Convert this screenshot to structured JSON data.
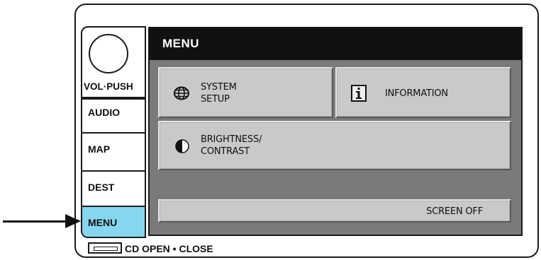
{
  "side_panel": {
    "knob_label": "VOL·PUSH",
    "buttons": [
      {
        "label": "AUDIO"
      },
      {
        "label": "MAP"
      },
      {
        "label": "DEST"
      },
      {
        "label": "MENU",
        "selected": true,
        "highlight_color": "#87d6f0"
      }
    ]
  },
  "screen": {
    "title": "MENU",
    "tiles": {
      "system_setup": {
        "line1": "SYSTEM",
        "line2": "SETUP",
        "icon": "globe-icon"
      },
      "information": {
        "label": "INFORMATION",
        "icon": "info-icon"
      },
      "brightness": {
        "line1": "BRIGHTNESS/",
        "line2": "CONTRAST",
        "icon": "contrast-icon"
      },
      "screen_off": {
        "label": "SCREEN OFF"
      }
    }
  },
  "cd": {
    "label": "CD OPEN • CLOSE"
  },
  "colors": {
    "header": "#111111",
    "screen_bg": "#7a7a7a",
    "tile": "#c9c9c9",
    "selected": "#87d6f0"
  }
}
